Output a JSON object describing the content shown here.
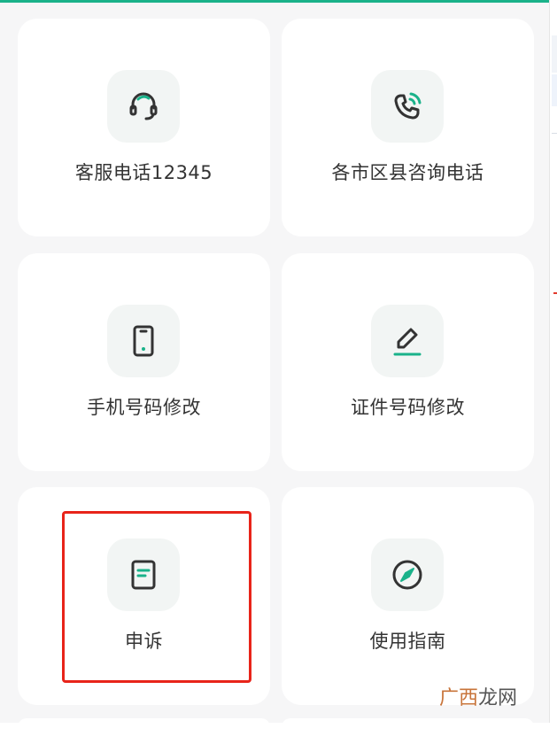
{
  "services": [
    {
      "label": "客服电话12345",
      "icon": "headset-icon"
    },
    {
      "label": "各市区县咨询电话",
      "icon": "phone-ringing-icon"
    },
    {
      "label": "手机号码修改",
      "icon": "mobile-phone-icon"
    },
    {
      "label": "证件号码修改",
      "icon": "edit-pencil-icon"
    },
    {
      "label": "申诉",
      "icon": "document-icon"
    },
    {
      "label": "使用指南",
      "icon": "compass-icon"
    }
  ],
  "colors": {
    "accent": "#1ab28a",
    "icon_dark": "#333333",
    "highlight": "#e8241a"
  },
  "watermark": {
    "part1": "广西",
    "part2": "龙网"
  }
}
